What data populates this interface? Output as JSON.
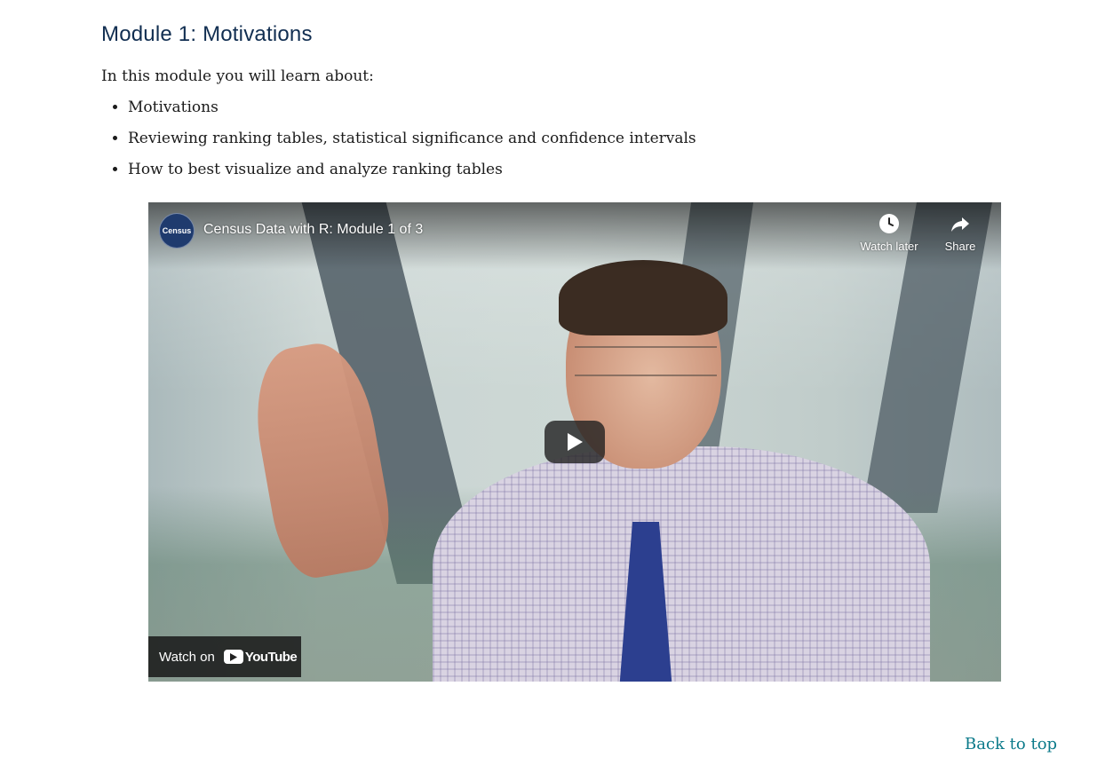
{
  "section": {
    "heading": "Module 1: Motivations",
    "intro": "In this module you will learn about:",
    "topics": [
      "Motivations",
      "Reviewing ranking tables, statistical significance and confidence intervals",
      "How to best visualize and analyze ranking tables"
    ]
  },
  "video": {
    "title": "Census Data with R: Module 1 of 3",
    "channel_avatar_text": "Census",
    "watch_later_label": "Watch later",
    "share_label": "Share",
    "watch_on_label": "Watch on",
    "youtube_label": "YouTube",
    "icons": {
      "watch_later": "clock-icon",
      "share": "share-arrow-icon",
      "play": "play-icon",
      "youtube": "youtube-logo-icon"
    }
  },
  "footer": {
    "back_to_top": "Back to top"
  },
  "colors": {
    "heading": "#112e51",
    "link": "#0b7a8a",
    "youtube_red": "#ff0000"
  }
}
